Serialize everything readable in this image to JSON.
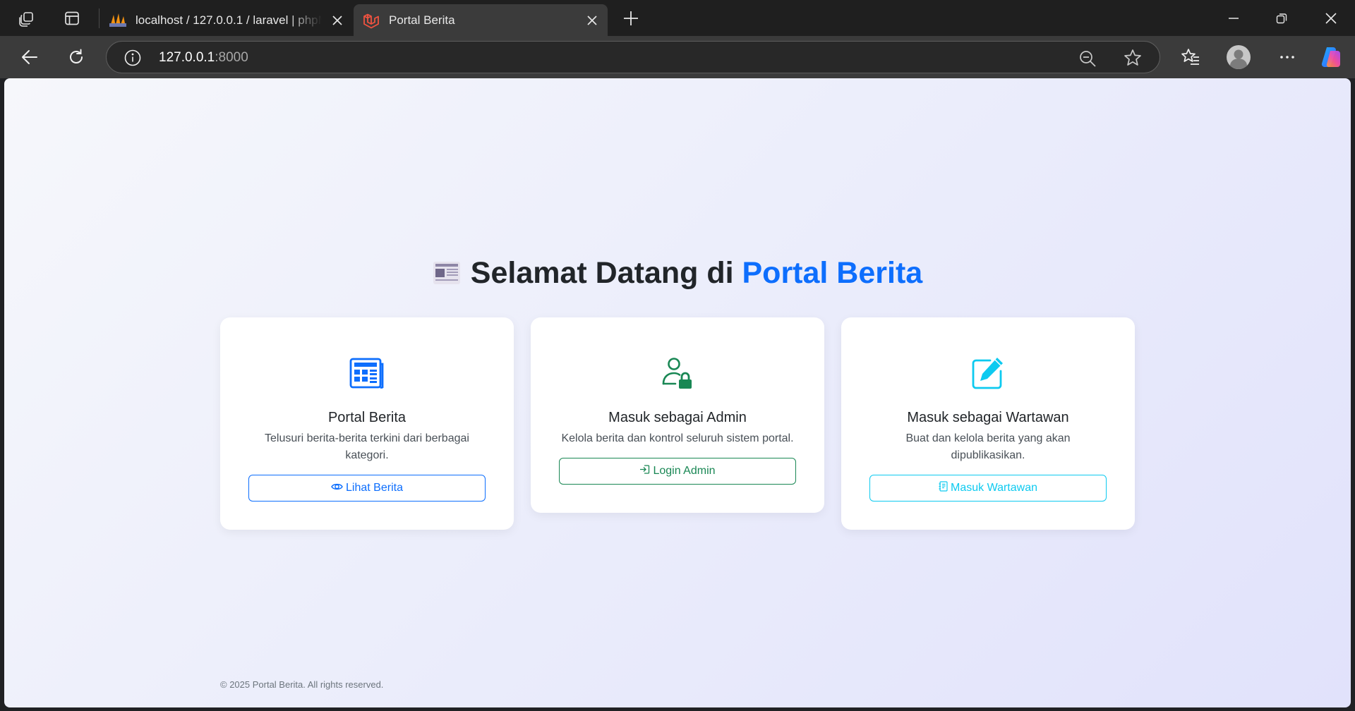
{
  "browser": {
    "tabs": [
      {
        "title": "localhost / 127.0.0.1 / laravel | phpMyAdmin",
        "icon": "phpmyadmin-icon",
        "active": false
      },
      {
        "title": "Portal Berita",
        "icon": "laravel-icon",
        "active": true
      }
    ],
    "address": {
      "host": "127.0.0.1",
      "port": ":8000"
    }
  },
  "page": {
    "heading": {
      "prefix": "Selamat Datang di ",
      "brand": "Portal Berita",
      "icon": "newspaper-icon"
    },
    "cards": [
      {
        "icon": "news-grid-icon",
        "title": "Portal Berita",
        "description": "Telusuri berita-berita terkini dari berbagai kategori.",
        "button_icon": "eye-icon",
        "button_label": "Lihat Berita",
        "accent": "#0d6efd"
      },
      {
        "icon": "person-lock-icon",
        "title": "Masuk sebagai Admin",
        "description": "Kelola berita dan kontrol seluruh sistem portal.",
        "button_icon": "login-icon",
        "button_label": "Login Admin",
        "accent": "#198754"
      },
      {
        "icon": "pencil-square-icon",
        "title": "Masuk sebagai Wartawan",
        "description": "Buat dan kelola berita yang akan dipublikasikan.",
        "button_icon": "journal-icon",
        "button_label": "Masuk Wartawan",
        "accent": "#0dcaf0"
      }
    ],
    "footer": "© 2025 Portal Berita. All rights reserved."
  },
  "colors": {
    "brand": "#0d6efd",
    "success": "#198754",
    "info": "#0dcaf0",
    "heading": "#212529"
  }
}
